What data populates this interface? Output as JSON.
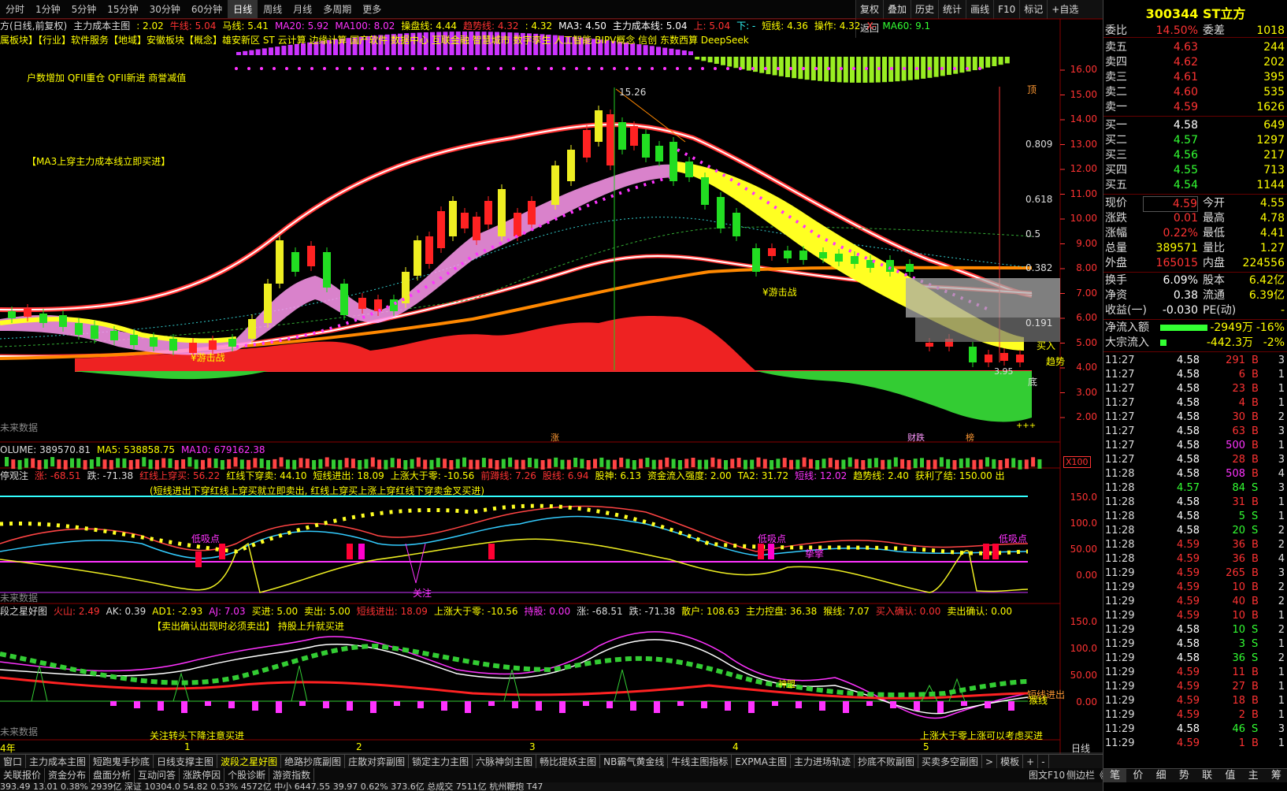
{
  "topbar": {
    "items": [
      "分时",
      "1分钟",
      "5分钟",
      "15分钟",
      "30分钟",
      "60分钟",
      "日线",
      "周线",
      "月线",
      "多周期",
      "更多"
    ],
    "active": 6,
    "tools": [
      "复权",
      "叠加",
      "历史",
      "统计",
      "画线",
      "F10",
      "标记",
      "+自选",
      "返回"
    ]
  },
  "main": {
    "line1": {
      "name": "方(日线,前复权)",
      "indicator": "主力成本主图",
      "vals": [
        ": 2.02",
        "牛线: 5.04",
        "马线: 5.41",
        "MA20: 5.92",
        "MA100: 8.02",
        "操盘线: 4.44",
        "趋势线: 4.32",
        ": 4.32",
        "MA3: 4.50",
        "主力成本线: 5.04",
        "上: 5.04",
        "下: -",
        "短线: 4.36",
        "操作: 4.32",
        "X-",
        "MA60: 9.1"
      ]
    },
    "line2": "属板块】【行业】软件服务【地域】安徽板块【概念】雄安新区 ST 云计算 边缘计算 国产软件 数据中心 互联金融 智慧城市 数字孪生 人工智能 BIPV概念 信创 东数西算 DeepSeek",
    "line3": "户数增加 QFII重仓 QFII新进 商誉减值",
    "note1": "【MA3上穿主力成本线立即买进】",
    "peak": "15.26",
    "low_mark": "3.95",
    "fib": [
      "0.809",
      "0.618",
      "0.5",
      "0.382",
      "0.191"
    ],
    "labels": {
      "youji1": "¥游击战",
      "youji2": "¥游击战",
      "top": "顶",
      "bottom": "底",
      "buy": "买入",
      "trend": "趋势",
      "future": "未来数据",
      "zhang": "涨",
      "caidie": "财跌",
      "bang": "榜",
      "plus": "+++"
    },
    "yaxis": [
      "16.00",
      "15.00",
      "14.00",
      "13.00",
      "12.00",
      "11.00",
      "10.00",
      "9.00",
      "8.00",
      "7.00",
      "6.00",
      "5.00",
      "4.00",
      "3.00",
      "2.00"
    ]
  },
  "volume": {
    "vals": [
      "OLUME: 389570.81",
      "MA5: 538858.75",
      "MA10: 679162.38"
    ],
    "x100": "X100"
  },
  "ind1": {
    "vals": [
      "停观注",
      "涨: -68.51",
      "跌: -71.38",
      "红线上穿买: 56.22",
      "红线下穿卖: 44.10",
      "短线进出: 18.09",
      "上涨大于零: -10.56",
      "前蹲线: 7.26",
      "股线: 6.94",
      "股神: 6.13",
      "资金流入强度: 2.00",
      "TA2: 31.72",
      "短线: 12.02",
      "趋势线: 2.40",
      "获利了结: 150.00 出"
    ],
    "note": "(短线进出下穿红线上穿买就立即卖出,  红线上穿买上涨上穿红线下穿卖金叉买进)",
    "yaxis": [
      "150.0",
      "100.0",
      "50.00",
      "0.00"
    ],
    "labels": {
      "xi1": "低吸点",
      "xi2": "低吸点",
      "xi3": "低吸点",
      "guanzhu": "关注",
      "zhiqin": "挚擎",
      "future": "未来数据"
    }
  },
  "ind2": {
    "vals": [
      "段之星好图",
      "火山: 2.49",
      "AK: 0.39",
      "AD1: -2.93",
      "AJ: 7.03",
      "买进: 5.00",
      "卖出: 5.00",
      "短线进出: 18.09",
      "上涨大于零: -10.56",
      "持股: 0.00",
      "涨: -68.51",
      "跌: -71.38",
      "散户: 108.63",
      "主力控盘: 36.38",
      "猴线: 7.07",
      "买入确认: 0.00",
      "卖出确认: 0.00"
    ],
    "note1": "【卖出确认出现时必须卖出】 持股上升就买进",
    "note2": "关注转头下降注意买进",
    "note3": "上涨大于零上涨可以考虑买进",
    "tail1": "短线进出",
    "tail2": "猴线",
    "yaxis": [
      "150.0",
      "100.0",
      "50.00",
      "0.00"
    ],
    "future": "未来数据",
    "shenwei": "神盟"
  },
  "dates": {
    "d0": "4年",
    "d1": "1",
    "d2": "2",
    "d3": "3",
    "d4": "4",
    "d5": "5",
    "period": "日线"
  },
  "tabs": [
    "窗口",
    "主力成本主图",
    "短跑鬼手抄底",
    "日线支撑主图",
    "波段之星好图",
    "绝路抄底副图",
    "庄散对弈副图",
    "锁定主力主图",
    "六脉神剑主图",
    "畅比提妖主图",
    "NB霸气黄金线",
    "牛线主图指标",
    "EXPMA主图",
    "主力进场轨迹",
    "抄底不败副图",
    "买卖多空副图",
    ">",
    "模板",
    "+",
    "-"
  ],
  "tab_active": 4,
  "btabs": [
    "关联报价",
    "资金分布",
    "盘面分析",
    "互动问答",
    "涨跌停因",
    "个股诊断",
    "游资指数"
  ],
  "status": "393.49  13.01  0.38%   2939亿   深证 10304.0  54.82  0.53%   4572亿   中小 6447.55  39.97  0.62%   373.6亿   总成交 7511亿   杭州鞭炮 T47",
  "right": {
    "code": "300344 ST立方",
    "weibi": {
      "label": "委比",
      "pct": "14.50%",
      "label2": "委差",
      "val": "1018"
    },
    "sells": [
      {
        "l": "卖五",
        "p": "4.63",
        "v": "244"
      },
      {
        "l": "卖四",
        "p": "4.62",
        "v": "202"
      },
      {
        "l": "卖三",
        "p": "4.61",
        "v": "395"
      },
      {
        "l": "卖二",
        "p": "4.60",
        "v": "535"
      },
      {
        "l": "卖一",
        "p": "4.59",
        "v": "1626"
      }
    ],
    "buys": [
      {
        "l": "买一",
        "p": "4.58",
        "v": "649"
      },
      {
        "l": "买二",
        "p": "4.57",
        "v": "1297"
      },
      {
        "l": "买三",
        "p": "4.56",
        "v": "217"
      },
      {
        "l": "买四",
        "p": "4.55",
        "v": "713"
      },
      {
        "l": "买五",
        "p": "4.54",
        "v": "1144"
      }
    ],
    "stats": [
      {
        "l1": "现价",
        "v1": "4.59",
        "l2": "今开",
        "v2": "4.55",
        "c1": "red",
        "c2": "grn"
      },
      {
        "l1": "涨跌",
        "v1": "0.01",
        "l2": "最高",
        "v2": "4.78",
        "c1": "red",
        "c2": "red"
      },
      {
        "l1": "涨幅",
        "v1": "0.22%",
        "l2": "最低",
        "v2": "4.41",
        "c1": "red",
        "c2": "grn"
      },
      {
        "l1": "总量",
        "v1": "389571",
        "l2": "量比",
        "v2": "1.27",
        "c1": "yel",
        "c2": "red"
      },
      {
        "l1": "外盘",
        "v1": "165015",
        "l2": "内盘",
        "v2": "224556",
        "c1": "red",
        "c2": "grn"
      },
      {
        "l1": "换手",
        "v1": "6.09%",
        "l2": "股本",
        "v2": "6.42亿",
        "c1": "wht",
        "c2": "wht"
      },
      {
        "l1": "净资",
        "v1": "0.38",
        "l2": "流通",
        "v2": "6.39亿",
        "c1": "wht",
        "c2": "wht"
      },
      {
        "l1": "收益(一)",
        "v1": "-0.030",
        "l2": "PE(动)",
        "v2": "-",
        "c1": "wht",
        "c2": "wht"
      }
    ],
    "flow": [
      {
        "l": "净流入额",
        "v": "-2949万",
        "p": "-16%",
        "frac": 0.75
      },
      {
        "l": "大宗流入",
        "v": "-442.3万",
        "p": "-2%",
        "frac": 0.1
      }
    ],
    "ticks": [
      [
        "11:27",
        "4.58",
        "291",
        "B",
        "3"
      ],
      [
        "11:27",
        "4.58",
        "6",
        "B",
        "1"
      ],
      [
        "11:27",
        "4.58",
        "23",
        "B",
        "1"
      ],
      [
        "11:27",
        "4.58",
        "4",
        "B",
        "1"
      ],
      [
        "11:27",
        "4.58",
        "30",
        "B",
        "2"
      ],
      [
        "11:27",
        "4.58",
        "63",
        "B",
        "3"
      ],
      [
        "11:27",
        "4.58",
        "500",
        "B",
        "1"
      ],
      [
        "11:27",
        "4.58",
        "28",
        "B",
        "3"
      ],
      [
        "11:28",
        "4.58",
        "508",
        "B",
        "4"
      ],
      [
        "11:28",
        "4.57",
        "84",
        "S",
        "3"
      ],
      [
        "11:28",
        "4.58",
        "31",
        "B",
        "1"
      ],
      [
        "11:28",
        "4.58",
        "5",
        "S",
        "1"
      ],
      [
        "11:28",
        "4.58",
        "20",
        "S",
        "2"
      ],
      [
        "11:28",
        "4.59",
        "36",
        "B",
        "2"
      ],
      [
        "11:28",
        "4.59",
        "36",
        "B",
        "4"
      ],
      [
        "11:29",
        "4.59",
        "265",
        "B",
        "3"
      ],
      [
        "11:29",
        "4.59",
        "10",
        "B",
        "2"
      ],
      [
        "11:29",
        "4.59",
        "40",
        "B",
        "2"
      ],
      [
        "11:29",
        "4.59",
        "10",
        "B",
        "1"
      ],
      [
        "11:29",
        "4.58",
        "10",
        "S",
        "2"
      ],
      [
        "11:29",
        "4.58",
        "3",
        "S",
        "1"
      ],
      [
        "11:29",
        "4.58",
        "36",
        "S",
        "2"
      ],
      [
        "11:29",
        "4.59",
        "11",
        "B",
        "1"
      ],
      [
        "11:29",
        "4.59",
        "27",
        "B",
        "1"
      ],
      [
        "11:29",
        "4.59",
        "18",
        "B",
        "1"
      ],
      [
        "11:29",
        "4.59",
        "2",
        "B",
        "1"
      ],
      [
        "11:29",
        "4.58",
        "46",
        "S",
        "3"
      ],
      [
        "11:29",
        "4.59",
        "1",
        "B",
        "1"
      ]
    ],
    "bottom": [
      "笔",
      "价",
      "细",
      "势",
      "联",
      "值",
      "主",
      "筹"
    ]
  },
  "status_right": {
    "a": "图文F10",
    "b": "侧边栏《"
  }
}
